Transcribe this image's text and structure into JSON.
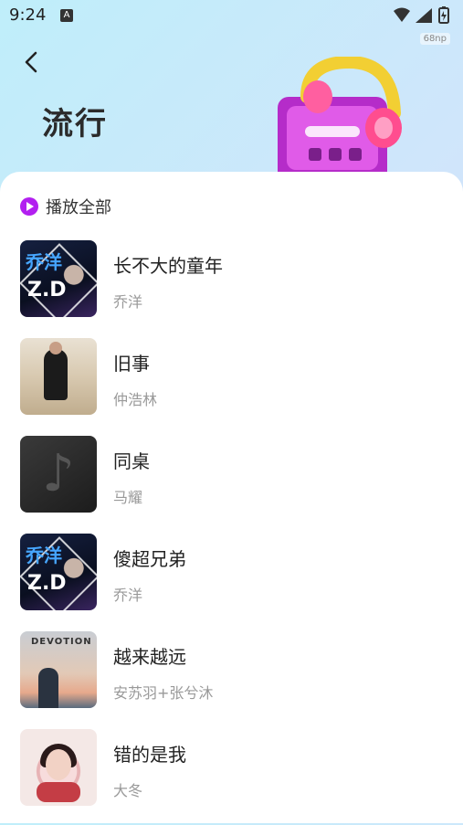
{
  "status_bar": {
    "time": "9:24",
    "a_badge": "A",
    "np_badge": "68np"
  },
  "header": {
    "title": "流行"
  },
  "play_all": {
    "label": "播放全部"
  },
  "accent_color": "#b21ff0",
  "songs": [
    {
      "title": "长不大的童年",
      "artist": "乔洋"
    },
    {
      "title": "旧事",
      "artist": "仲浩林"
    },
    {
      "title": "同桌",
      "artist": "马耀"
    },
    {
      "title": "傻超兄弟",
      "artist": "乔洋"
    },
    {
      "title": "越来越远",
      "artist": "安苏羽+张兮沐"
    },
    {
      "title": "错的是我",
      "artist": "大冬"
    }
  ],
  "covers": {
    "qiao_text_a": "乔洋",
    "qiao_text_b": "Z.D",
    "devotion": "DEVOTION"
  }
}
